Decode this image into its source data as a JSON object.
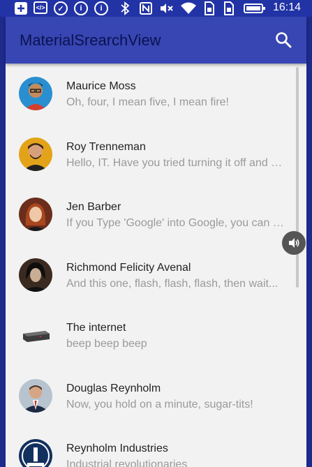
{
  "status_bar": {
    "time": "16:14",
    "icons": [
      "add-box-icon",
      "code-icon",
      "check-circle-icon",
      "info-circle-icon",
      "info-circle-icon",
      "bluetooth-icon",
      "nfc-icon",
      "mute-icon",
      "wifi-icon",
      "sim-icon",
      "sim-icon",
      "battery-icon"
    ]
  },
  "app_bar": {
    "title": "MaterialSrearchView",
    "action_icon": "search-icon"
  },
  "contacts": [
    {
      "name": "Maurice Moss",
      "message": "Oh, four, I mean five, I mean fire!",
      "avatar_bg": "#2a8fd0"
    },
    {
      "name": "Roy Trenneman",
      "message": "Hello, IT. Have you tried turning it off and on again?",
      "avatar_bg": "#e3a319"
    },
    {
      "name": "Jen Barber",
      "message": "If you Type 'Google' into Google, you can break the internet.",
      "avatar_bg": "#6b2d1c"
    },
    {
      "name": "Richmond Felicity Avenal",
      "message": "And this one, flash, flash, flash, then wait...",
      "avatar_bg": "#3a2a20"
    },
    {
      "name": "The internet",
      "message": "beep beep beep",
      "avatar_bg": "#f2f2f2"
    },
    {
      "name": "Douglas Reynholm",
      "message": "Now, you hold on a minute, sugar-tits!",
      "avatar_bg": "#b7c4cf"
    },
    {
      "name": "Reynholm Industries",
      "message": "Industrial revolutionaries",
      "avatar_bg": "#12305e"
    }
  ],
  "colors": {
    "status_bar": "#2233a6",
    "app_bar": "#3746b2",
    "background": "#f2f2f2"
  },
  "overlay": {
    "icon": "volume-icon"
  }
}
